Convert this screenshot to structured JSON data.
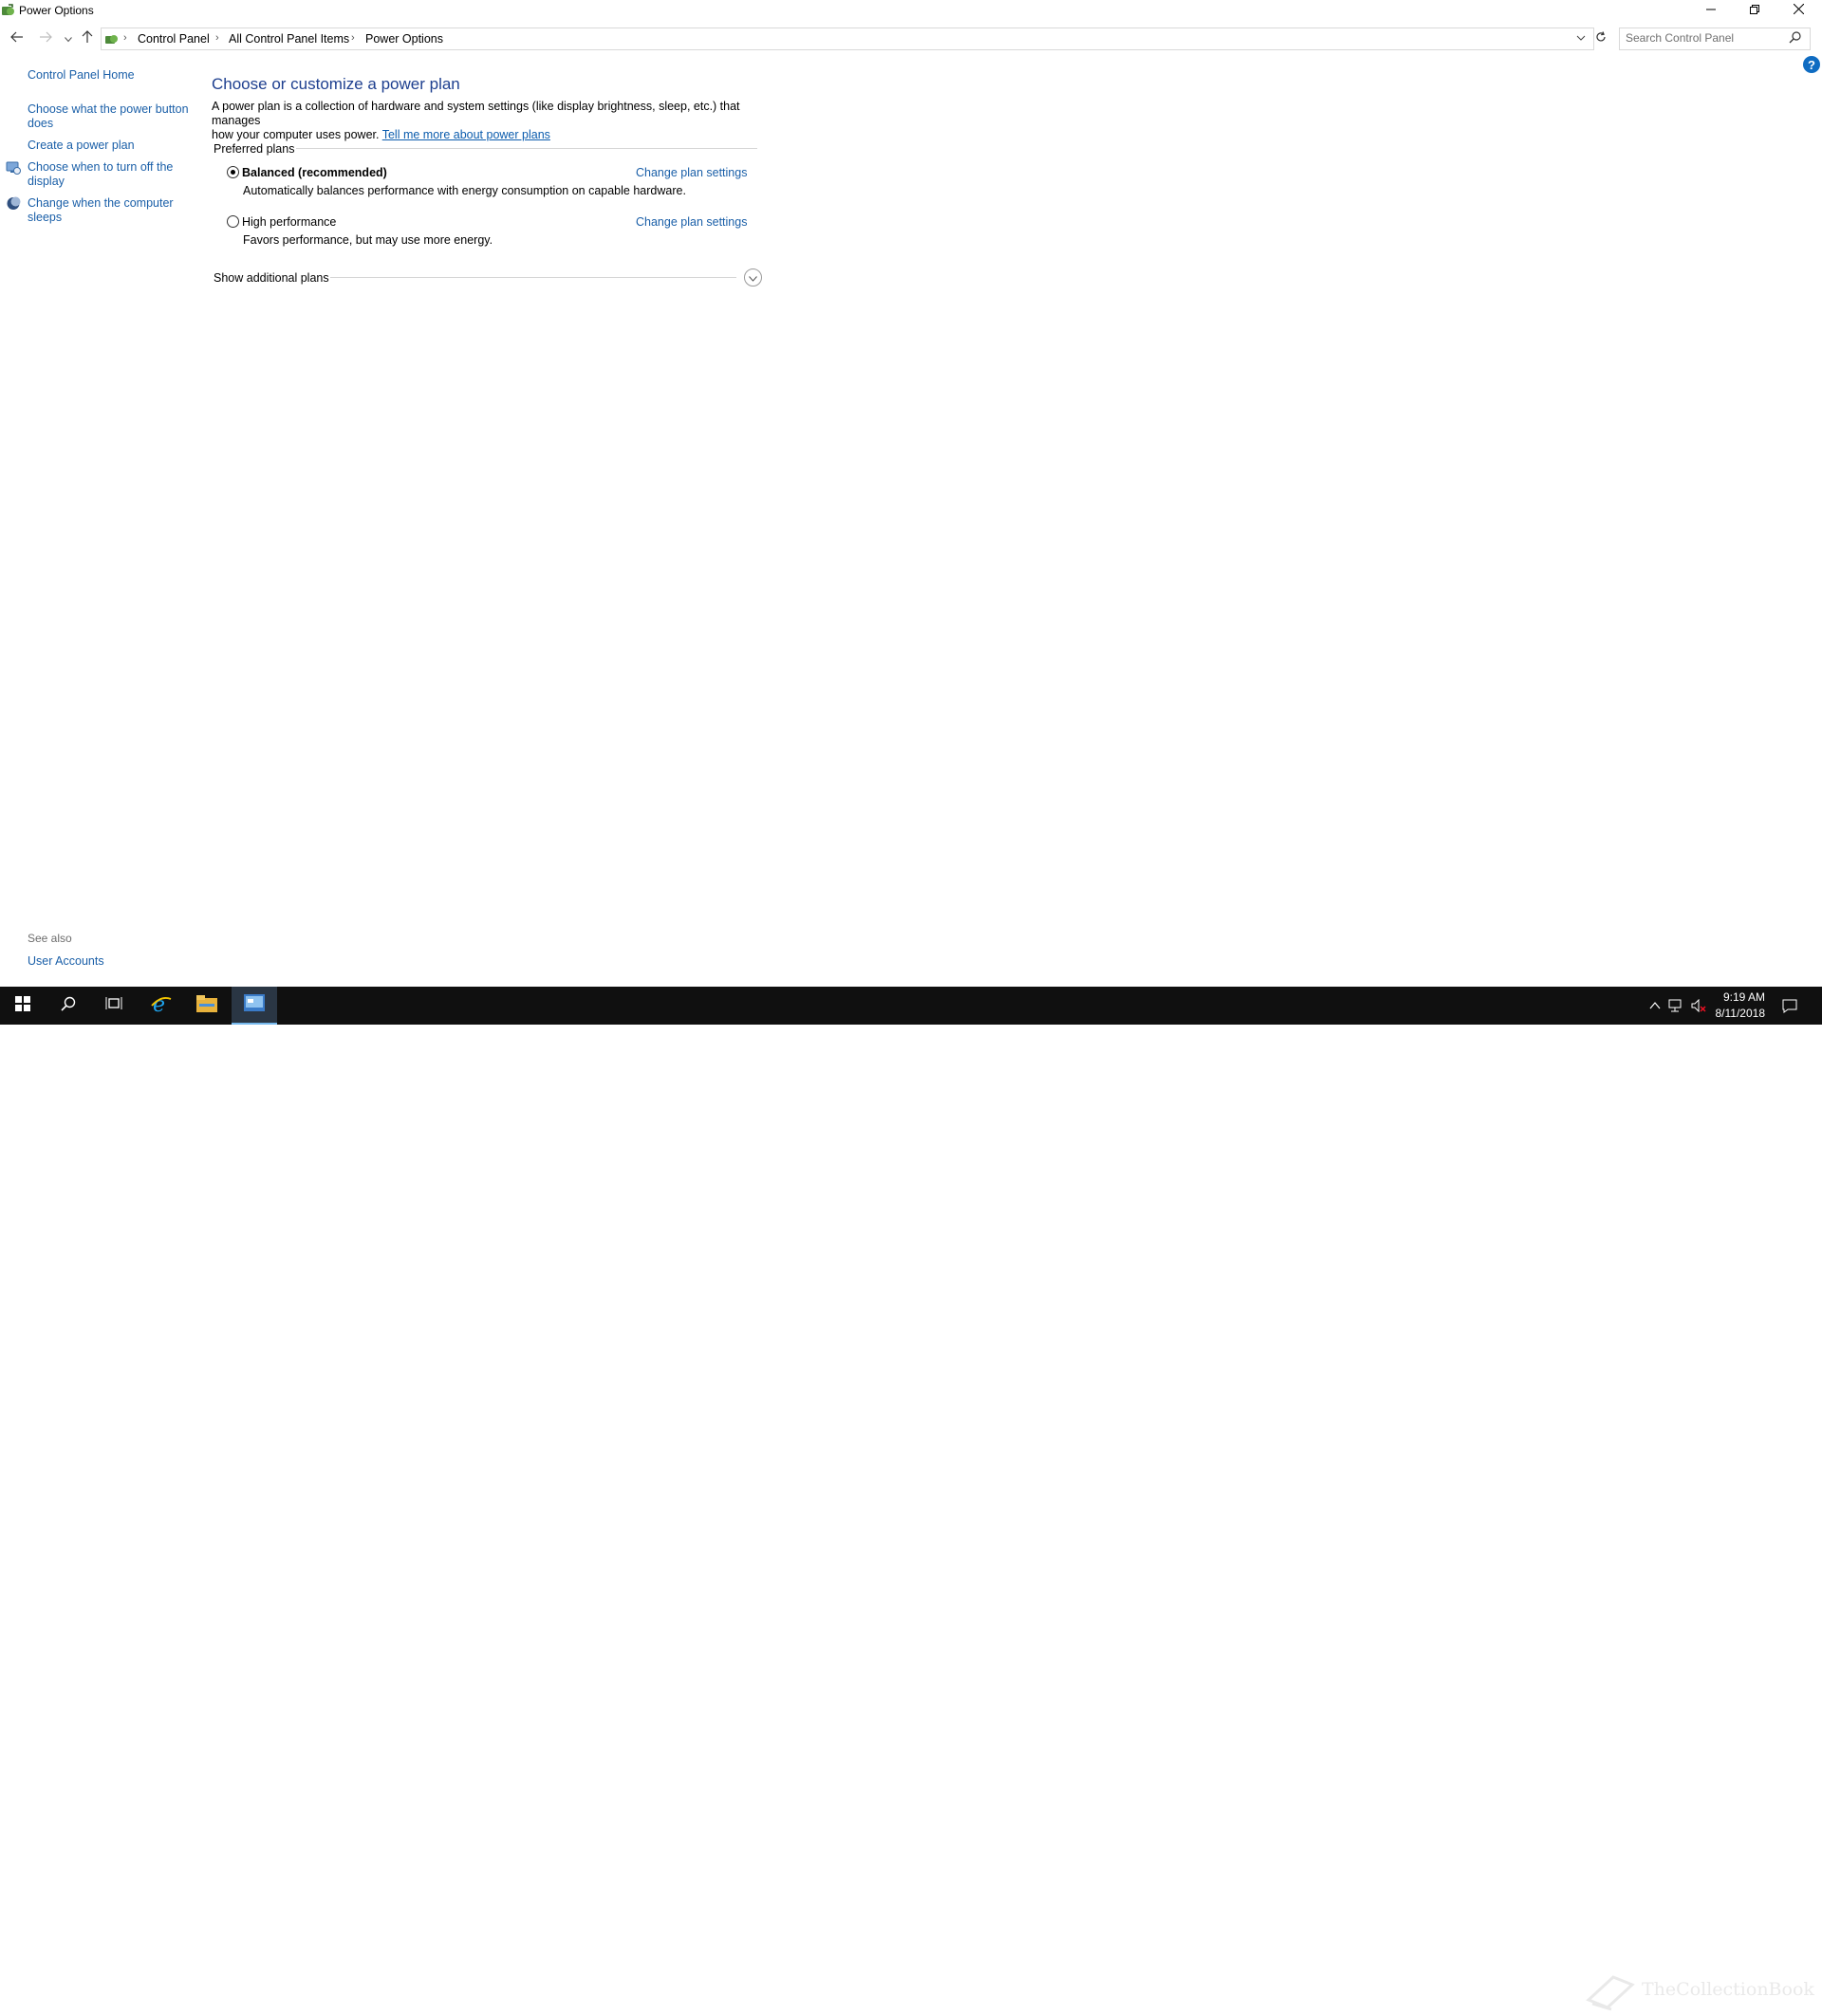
{
  "window": {
    "title": "Power Options",
    "icon": "power-options-icon",
    "controls": [
      "minimize-icon",
      "restore-icon",
      "close-icon"
    ]
  },
  "address": {
    "breadcrumbs": [
      "Control Panel",
      "All Control Panel Items",
      "Power Options"
    ],
    "search_placeholder": "Search Control Panel"
  },
  "sidebar": {
    "home": "Control Panel Home",
    "tasks": [
      {
        "label": "Choose what the power button does",
        "line1": "Choose what the power button",
        "line2": "does",
        "icon": ""
      },
      {
        "label": "Create a power plan",
        "line1": "Create a power plan",
        "line2": "",
        "icon": ""
      },
      {
        "label": "Choose when to turn off the display",
        "line1": "Choose when to turn off the",
        "line2": "display",
        "icon": "monitor-shield-icon"
      },
      {
        "label": "Change when the computer sleeps",
        "line1": "Change when the computer",
        "line2": "sleeps",
        "icon": "moon-icon"
      }
    ],
    "see_also_label": "See also",
    "see_also_links": [
      "User Accounts"
    ]
  },
  "main": {
    "title": "Choose or customize a power plan",
    "description_line1": "A power plan is a collection of hardware and system settings (like display brightness, sleep, etc.) that manages",
    "description_line2": "how your computer uses power.",
    "learn_more_link": "Tell me more about power plans",
    "preferred_label": "Preferred plans",
    "plans": [
      {
        "name": "Balanced (recommended)",
        "description": "Automatically balances performance with energy consumption on capable hardware.",
        "selected": true,
        "change_link": "Change plan settings"
      },
      {
        "name": "High performance",
        "description": "Favors performance, but may use more energy.",
        "selected": false,
        "change_link": "Change plan settings"
      }
    ],
    "additional_plans_label": "Show additional plans"
  },
  "taskbar": {
    "pinned": [
      "start-icon",
      "search-icon",
      "task-view-icon",
      "internet-explorer-icon",
      "file-explorer-icon",
      "control-panel-icon"
    ],
    "active": "control-panel-icon",
    "tray": [
      "chevron-up-icon",
      "network-icon",
      "volume-muted-icon",
      "notification-icon"
    ],
    "time": "9:19 AM",
    "date": "8/11/2018",
    "watermark": "TheCollectionBook"
  },
  "colors": {
    "link": "#1a5fa8",
    "title": "#1e3f8f",
    "taskbar": "#101010",
    "help": "#0f6cc2"
  }
}
